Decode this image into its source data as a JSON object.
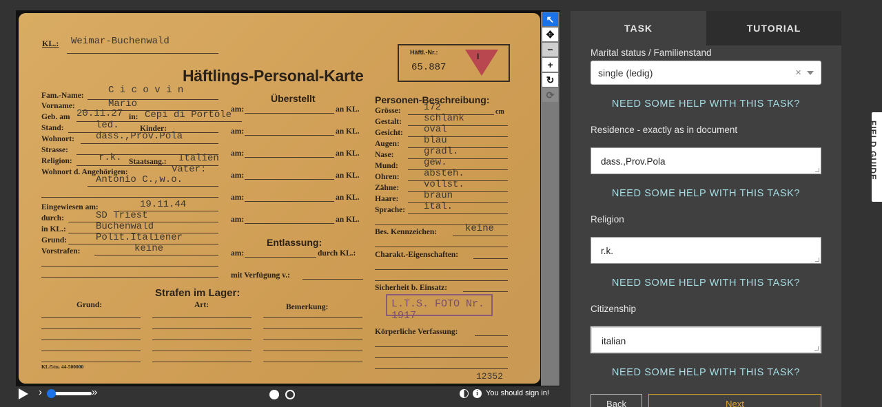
{
  "card": {
    "kl_label": "KL.:",
    "kl_value": "Weimar-Buchenwald",
    "title": "Häftlings-Personal-Karte",
    "number_label": "Häftl.-Nr.:",
    "number_value": "65.887",
    "triangle_letter": "I",
    "left": [
      {
        "label": "Fam.-Name:",
        "value": "C i c o v i n"
      },
      {
        "label": "Vorname:",
        "value": "Mario"
      },
      {
        "label": "Geb. am",
        "value": "20.11.27",
        "label2": "in:",
        "value2": "Cepi di Portole"
      },
      {
        "label": "Stand:",
        "value": "led.",
        "label2": "Kinder:",
        "value2": ""
      },
      {
        "label": "Wohnort:",
        "value": "dass.,Prov.Pola"
      },
      {
        "label": "Strasse:",
        "value": ""
      },
      {
        "label": "Religion:",
        "value": "r.k.",
        "label2": "Staatsang.:",
        "value2": "Italien"
      },
      {
        "label": "Wohnort d. Angehörigen:",
        "value": "Vater:"
      },
      {
        "label": "",
        "value": "Antonio C.,w.o."
      }
    ],
    "admission": [
      {
        "label": "Eingewiesen am:",
        "value": "19.11.44"
      },
      {
        "label": "durch:",
        "value": "SD Triest"
      },
      {
        "label": "in KL.:",
        "value": "Buchenwald"
      },
      {
        "label": "Grund:",
        "value": "Polit.Italiener"
      },
      {
        "label": "Vorstrafen:",
        "value": "keine"
      }
    ],
    "ueberstellt_title": "Überstellt",
    "am_label": "am:",
    "an_kl_label": "an KL.",
    "entlassung_title": "Entlassung:",
    "durch_kl_label": "durch KL.:",
    "verfuegung_label": "mit Verfügung v.:",
    "description_title": "Personen-Beschreibung:",
    "description": [
      {
        "label": "Grösse:",
        "value": "172",
        "unit": "cm"
      },
      {
        "label": "Gestalt:",
        "value": "schlank"
      },
      {
        "label": "Gesicht:",
        "value": "oval"
      },
      {
        "label": "Augen:",
        "value": "blau"
      },
      {
        "label": "Nase:",
        "value": "gradl."
      },
      {
        "label": "Mund:",
        "value": "gew."
      },
      {
        "label": "Ohren:",
        "value": "absteh."
      },
      {
        "label": "Zähne:",
        "value": "vollst."
      },
      {
        "label": "Haare:",
        "value": "braun"
      },
      {
        "label": "Sprache:",
        "value": "ital."
      }
    ],
    "kennzeichen_label": "Bes. Kennzeichen:",
    "kennzeichen_value": "keine",
    "charakter_label": "Charakt.-Eigenschaften:",
    "sicherheit_label": "Sicherheit b. Einsatz:",
    "stamp": "L.T.S. FOTO Nr. 1917",
    "koerper_label": "Körperliche Verfassung:",
    "strafen_title": "Strafen im Lager:",
    "grund_col": "Grund:",
    "art_col": "Art:",
    "bemerkung_col": "Bemerkung:",
    "footer_code": "KL/5/m. 44-500000",
    "footer_number": "12352"
  },
  "viewer": {
    "signin_text": "You should sign in!"
  },
  "panel": {
    "tab_task": "TASK",
    "tab_tutorial": "TUTORIAL",
    "marital_label": "Marital status / Familienstand",
    "marital_value": "single (ledig)",
    "help_text": "NEED SOME HELP WITH THIS TASK?",
    "residence_label": "Residence - exactly as in document",
    "residence_value": "dass.,Prov.Pola",
    "religion_label": "Religion",
    "religion_value": "r.k.",
    "citizenship_label": "Citizenship",
    "citizenship_value": "italian",
    "back_label": "Back",
    "next_label": "Next"
  },
  "field_guide_label": "FIELD GUIDE"
}
